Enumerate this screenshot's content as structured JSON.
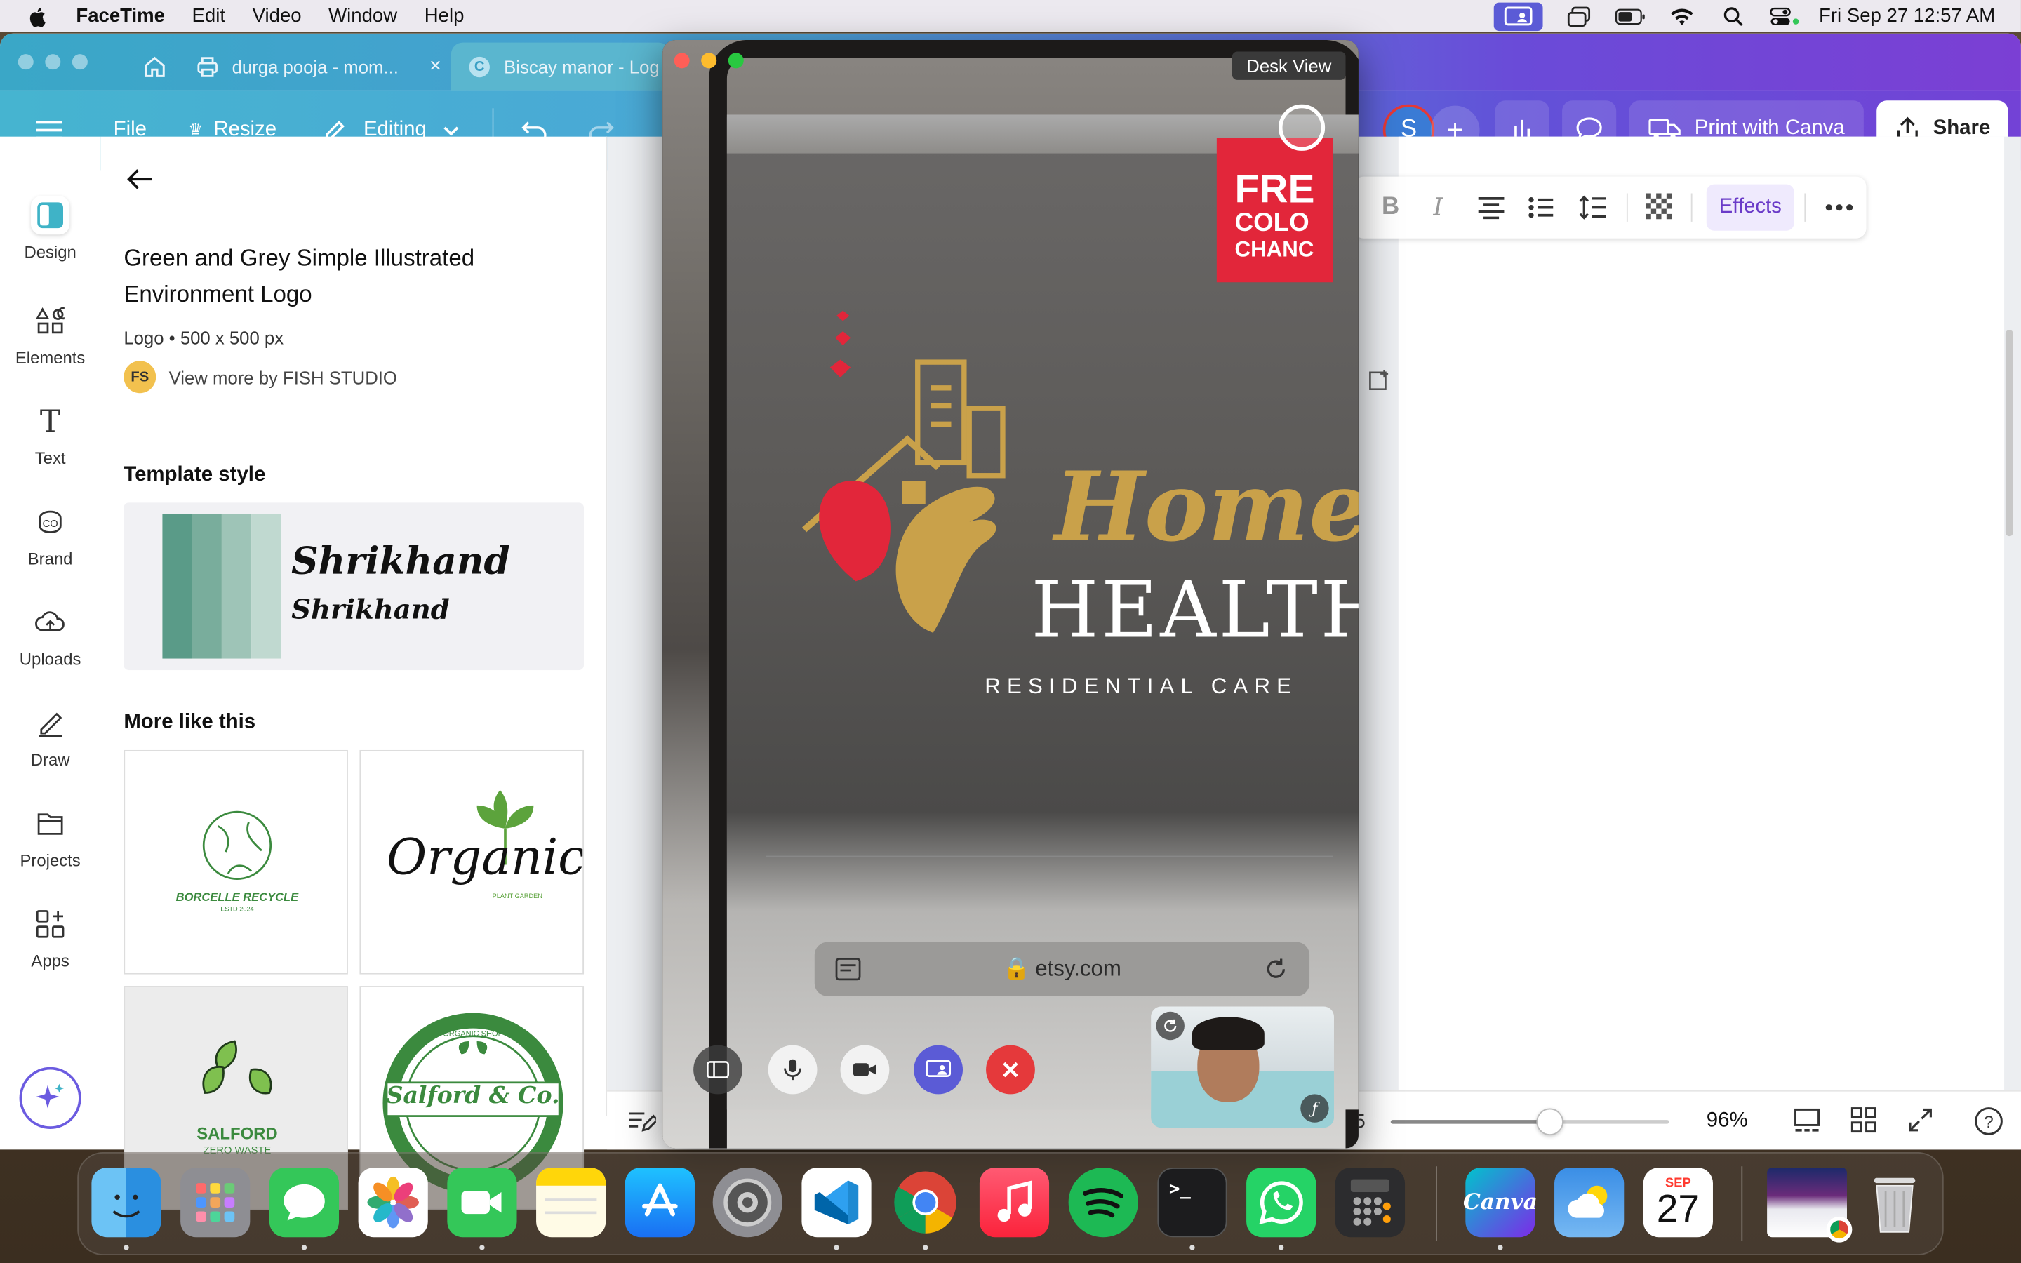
{
  "menubar": {
    "app": "FaceTime",
    "items": [
      "Edit",
      "Video",
      "Window",
      "Help"
    ],
    "clock": "Fri Sep 27  12:57 AM"
  },
  "browser": {
    "tabs": [
      {
        "label": "durga pooja - mom..."
      },
      {
        "label": "Biscay manor - Log"
      }
    ]
  },
  "toolbar": {
    "file": "File",
    "resize": "Resize",
    "editing": "Editing",
    "avatar": "S",
    "print": "Print with Canva",
    "share": "Share"
  },
  "context_bar": {
    "effects": "Effects"
  },
  "sidebar": {
    "items": [
      {
        "label": "Design",
        "icon": "design-icon"
      },
      {
        "label": "Elements",
        "icon": "elements-icon"
      },
      {
        "label": "Text",
        "icon": "text-icon"
      },
      {
        "label": "Brand",
        "icon": "brand-icon"
      },
      {
        "label": "Uploads",
        "icon": "uploads-icon"
      },
      {
        "label": "Draw",
        "icon": "draw-icon"
      },
      {
        "label": "Projects",
        "icon": "projects-icon"
      },
      {
        "label": "Apps",
        "icon": "apps-icon"
      }
    ]
  },
  "panel": {
    "title": "Green and Grey Simple Illustrated Environment Logo",
    "meta": "Logo • 500 x 500 px",
    "author_initials": "FS",
    "author_link": "View more by FISH STUDIO",
    "template_style_heading": "Template style",
    "font_sample": "Shrikhand",
    "more_heading": "More like this",
    "thumbs": [
      {
        "title": "BORCELLE RECYCLE",
        "sub": "ESTD 2024"
      },
      {
        "title": "Organic",
        "sub": "PLANT GARDEN"
      },
      {
        "title": "SALFORD",
        "sub": "ZERO WASTE"
      },
      {
        "title": "Salford & Co.",
        "sub": "ORGANIC SHOP"
      }
    ]
  },
  "bottom_bar": {
    "zoom": "96%",
    "page_fragment": "5",
    "slider_level": 0.57
  },
  "facetime": {
    "desk_view": "Desk View",
    "logo_word1": "Home",
    "logo_word2": "HEALTH",
    "logo_tagline": "RESIDENTIAL CARE",
    "banner": [
      "FRE",
      "COLO",
      "CHANC"
    ],
    "url": "etsy.com"
  },
  "dock": {
    "canva_label": "Canva",
    "calendar_month": "SEP",
    "calendar_day": "27"
  },
  "colors": {
    "canva_accent": "#7342d6",
    "end_call": "#e5393b",
    "share_screen": "#5b5bd6"
  }
}
